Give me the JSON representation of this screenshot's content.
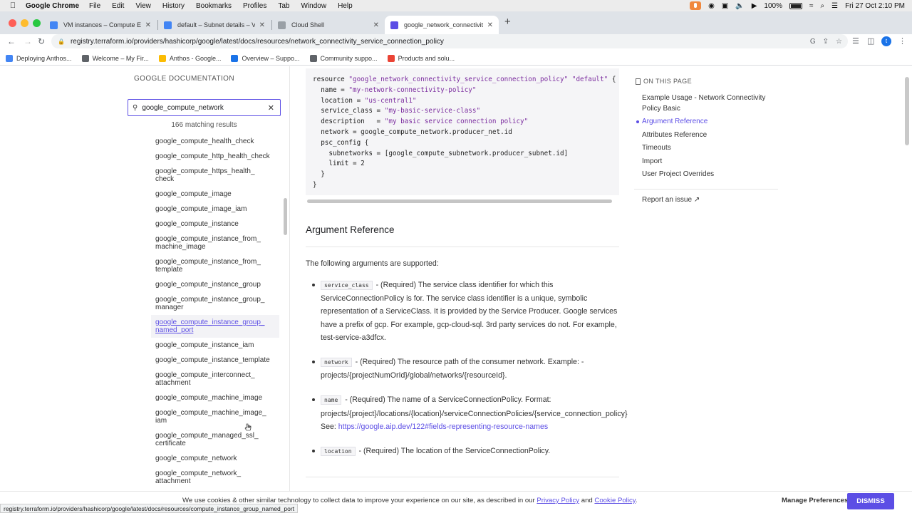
{
  "menubar": {
    "app_name": "Google Chrome",
    "items": [
      "File",
      "Edit",
      "View",
      "History",
      "Bookmarks",
      "Profiles",
      "Tab",
      "Window",
      "Help"
    ],
    "battery": "100%",
    "datetime": "Fri 27 Oct  2:10 PM"
  },
  "tabs": [
    {
      "title": "VM instances – Compute Eng",
      "favicon_color": "#4285f4"
    },
    {
      "title": "default – Subnet details – VPC",
      "favicon_color": "#4285f4"
    },
    {
      "title": "Cloud Shell",
      "favicon_color": "#9aa0a6"
    },
    {
      "title": "google_network_connectivity",
      "favicon_color": "#5c4ee5",
      "active": true
    }
  ],
  "address_bar": {
    "url": "registry.terraform.io/providers/hashicorp/google/latest/docs/resources/network_connectivity_service_connection_policy"
  },
  "bookmarks": [
    {
      "label": "Deploying Anthos...",
      "color": "#4285f4"
    },
    {
      "label": "Welcome – My Fir...",
      "color": "#5f6368"
    },
    {
      "label": "Anthos - Google...",
      "color": "#fbbc04"
    },
    {
      "label": "Overview – Suppo...",
      "color": "#1a73e8"
    },
    {
      "label": "Community suppo...",
      "color": "#5f6368"
    },
    {
      "label": "Products and solu...",
      "color": "#ea4335"
    }
  ],
  "sidebar": {
    "heading": "GOOGLE DOCUMENTATION",
    "search_value": "google_compute_network",
    "match_count": "166 matching results",
    "results": [
      "google_compute_health_check",
      "google_compute_http_health_check",
      "google_compute_https_health_\ncheck",
      "google_compute_image",
      "google_compute_image_iam",
      "google_compute_instance",
      "google_compute_instance_from_\nmachine_image",
      "google_compute_instance_from_\ntemplate",
      "google_compute_instance_group",
      "google_compute_instance_group_\nmanager",
      "google_compute_instance_group_\nnamed_port",
      "google_compute_instance_iam",
      "google_compute_instance_template",
      "google_compute_interconnect_\nattachment",
      "google_compute_machine_image",
      "google_compute_machine_image_\niam",
      "google_compute_managed_ssl_\ncertificate",
      "google_compute_network",
      "google_compute_network_\nattachment"
    ],
    "hovered_index": 10
  },
  "code_block": {
    "lines": [
      [
        [
          "resource ",
          ""
        ],
        [
          "\"google_network_connectivity_service_connection_policy\"",
          "str"
        ],
        [
          " ",
          ""
        ],
        [
          "\"default\"",
          "str"
        ],
        [
          " {",
          ""
        ]
      ],
      [
        [
          "  name = ",
          ""
        ],
        [
          "\"my-network-connectivity-policy\"",
          "str"
        ]
      ],
      [
        [
          "  location = ",
          ""
        ],
        [
          "\"us-central1\"",
          "str"
        ]
      ],
      [
        [
          "  service_class = ",
          ""
        ],
        [
          "\"my-basic-service-class\"",
          "str"
        ]
      ],
      [
        [
          "  description   = ",
          ""
        ],
        [
          "\"my basic service connection policy\"",
          "str"
        ]
      ],
      [
        [
          "  network = google_compute_network.producer_net.id",
          ""
        ]
      ],
      [
        [
          "  psc_config {",
          ""
        ]
      ],
      [
        [
          "    subnetworks = [google_compute_subnetwork.producer_subnet.id]",
          ""
        ]
      ],
      [
        [
          "    limit = 2",
          ""
        ]
      ],
      [
        [
          "  }",
          ""
        ]
      ],
      [
        [
          "}",
          ""
        ]
      ]
    ]
  },
  "main": {
    "heading": "Argument Reference",
    "intro": "The following arguments are supported:",
    "args": [
      {
        "code": "service_class",
        "text": " - (Required) The service class identifier for which this ServiceConnectionPolicy is for. The service class identifier is a unique, symbolic representation of a ServiceClass. It is provided by the Service Producer. Google services have a prefix of gcp. For example, gcp-cloud-sql. 3rd party services do not. For example, test-service-a3dfcx.",
        "link": ""
      },
      {
        "code": "network",
        "text": " - (Required) The resource path of the consumer network. Example: - projects/{projectNumOrId}/global/networks/{resourceId}.",
        "link": ""
      },
      {
        "code": "name",
        "text": " - (Required) The name of a ServiceConnectionPolicy. Format: projects/{project}/locations/{location}/serviceConnectionPolicies/{service_connection_policy} See: ",
        "link": "https://google.aip.dev/122#fields-representing-resource-names"
      },
      {
        "code": "location",
        "text": " - (Required) The location of the ServiceConnectionPolicy.",
        "link": ""
      }
    ]
  },
  "toc": {
    "heading": "ON THIS PAGE",
    "items": [
      "Example Usage - Network Connectivity Policy Basic",
      "Argument Reference",
      "Attributes Reference",
      "Timeouts",
      "Import",
      "User Project Overrides"
    ],
    "active_index": 1,
    "report": "Report an issue"
  },
  "cookie": {
    "text_before": "We use cookies & other similar technology to collect data to improve your experience on our site, as described in our ",
    "privacy_link": "Privacy Policy",
    "and": " and ",
    "cookie_link": "Cookie Policy",
    "end": ".",
    "manage": "Manage Preferences",
    "dismiss": "DISMISS"
  },
  "status_url": "registry.terraform.io/providers/hashicorp/google/latest/docs/resources/compute_instance_group_named_port",
  "colors": {
    "accent": "#5c4ee5"
  }
}
